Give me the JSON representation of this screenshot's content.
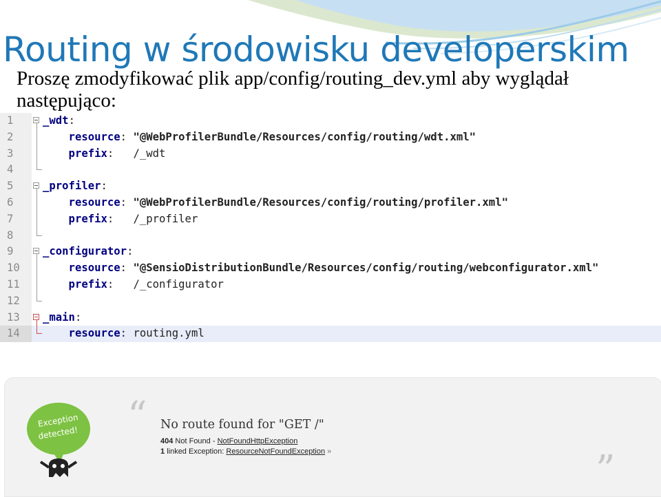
{
  "slide": {
    "title": "Routing w środowisku developerskim",
    "body": "Proszę zmodyfikować plik app/config/routing_dev.yml aby wyglądał następująco:"
  },
  "editor": {
    "lines": [
      {
        "num": "1",
        "key": "_wdt",
        "sep": ":",
        "value": ""
      },
      {
        "num": "2",
        "key": "    resource",
        "sep": ":",
        "value": " \"@WebProfilerBundle/Resources/config/routing/wdt.xml\""
      },
      {
        "num": "3",
        "key": "    prefix",
        "sep": ":",
        "value": "   /_wdt"
      },
      {
        "num": "4",
        "key": "",
        "sep": "",
        "value": ""
      },
      {
        "num": "5",
        "key": "_profiler",
        "sep": ":",
        "value": ""
      },
      {
        "num": "6",
        "key": "    resource",
        "sep": ":",
        "value": " \"@WebProfilerBundle/Resources/config/routing/profiler.xml\""
      },
      {
        "num": "7",
        "key": "    prefix",
        "sep": ":",
        "value": "   /_profiler"
      },
      {
        "num": "8",
        "key": "",
        "sep": "",
        "value": ""
      },
      {
        "num": "9",
        "key": "_configurator",
        "sep": ":",
        "value": ""
      },
      {
        "num": "10",
        "key": "    resource",
        "sep": ":",
        "value": " \"@SensioDistributionBundle/Resources/config/routing/webconfigurator.xml\""
      },
      {
        "num": "11",
        "key": "    prefix",
        "sep": ":",
        "value": "   /_configurator"
      },
      {
        "num": "12",
        "key": "",
        "sep": "",
        "value": ""
      },
      {
        "num": "13",
        "key": "_main",
        "sep": ":",
        "value": ""
      },
      {
        "num": "14",
        "key": "    resource",
        "sep": ":",
        "value": " routing.yml"
      }
    ],
    "current_line": "14"
  },
  "exception": {
    "badge_text_1": "Exception",
    "badge_text_2": "detected!",
    "quote_open": "“",
    "quote_close": "”",
    "title": "No route found for \"GET /\"",
    "status_code": "404",
    "status_text": "Not Found - ",
    "status_link": "NotFoundHttpException",
    "linked_count": "1",
    "linked_text": "linked Exception: ",
    "linked_link": "ResourceNotFoundException",
    "linked_arrow": "»"
  },
  "colors": {
    "title": "#1f78b7",
    "keyword": "#000080",
    "badge": "#7dc242",
    "current_line": "#e8edf9"
  }
}
